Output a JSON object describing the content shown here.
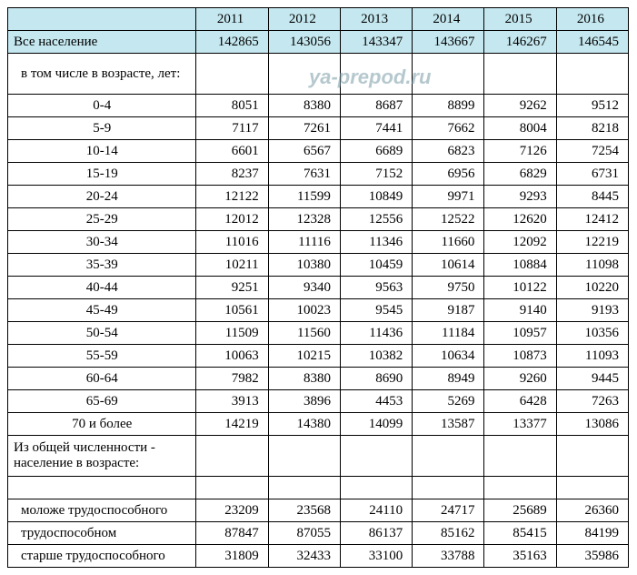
{
  "watermark": "ya-prepod.ru",
  "years": [
    "2011",
    "2012",
    "2013",
    "2014",
    "2015",
    "2016"
  ],
  "total_label": "Все население",
  "total_values": [
    "142865",
    "143056",
    "143347",
    "143667",
    "146267",
    "146545"
  ],
  "age_header": "в том числе в возрасте, лет:",
  "age_rows": [
    {
      "label": "0-4",
      "values": [
        "8051",
        "8380",
        "8687",
        "8899",
        "9262",
        "9512"
      ]
    },
    {
      "label": "5-9",
      "values": [
        "7117",
        "7261",
        "7441",
        "7662",
        "8004",
        "8218"
      ]
    },
    {
      "label": "10-14",
      "values": [
        "6601",
        "6567",
        "6689",
        "6823",
        "7126",
        "7254"
      ]
    },
    {
      "label": "15-19",
      "values": [
        "8237",
        "7631",
        "7152",
        "6956",
        "6829",
        "6731"
      ]
    },
    {
      "label": "20-24",
      "values": [
        "12122",
        "11599",
        "10849",
        "9971",
        "9293",
        "8445"
      ]
    },
    {
      "label": "25-29",
      "values": [
        "12012",
        "12328",
        "12556",
        "12522",
        "12620",
        "12412"
      ]
    },
    {
      "label": "30-34",
      "values": [
        "11016",
        "11116",
        "11346",
        "11660",
        "12092",
        "12219"
      ]
    },
    {
      "label": "35-39",
      "values": [
        "10211",
        "10380",
        "10459",
        "10614",
        "10884",
        "11098"
      ]
    },
    {
      "label": "40-44",
      "values": [
        "9251",
        "9340",
        "9563",
        "9750",
        "10122",
        "10220"
      ]
    },
    {
      "label": "45-49",
      "values": [
        "10561",
        "10023",
        "9545",
        "9187",
        "9140",
        "9193"
      ]
    },
    {
      "label": "50-54",
      "values": [
        "11509",
        "11560",
        "11436",
        "11184",
        "10957",
        "10356"
      ]
    },
    {
      "label": "55-59",
      "values": [
        "10063",
        "10215",
        "10382",
        "10634",
        "10873",
        "11093"
      ]
    },
    {
      "label": "60-64",
      "values": [
        "7982",
        "8380",
        "8690",
        "8949",
        "9260",
        "9445"
      ]
    },
    {
      "label": "65-69",
      "values": [
        "3913",
        "3896",
        "4453",
        "5269",
        "6428",
        "7263"
      ]
    },
    {
      "label": "70 и более",
      "values": [
        "14219",
        "14380",
        "14099",
        "13587",
        "13377",
        "13086"
      ]
    }
  ],
  "group_header": "Из общей численности - население в возрасте:",
  "group_rows": [
    {
      "label": "моложе трудоспособного",
      "values": [
        "23209",
        "23568",
        "24110",
        "24717",
        "25689",
        "26360"
      ]
    },
    {
      "label": "трудоспособном",
      "values": [
        "87847",
        "87055",
        "86137",
        "85162",
        "85415",
        "84199"
      ]
    },
    {
      "label": "старше трудоспособного",
      "values": [
        "31809",
        "32433",
        "33100",
        "33788",
        "35163",
        "35986"
      ]
    }
  ],
  "chart_data": {
    "type": "table",
    "title": "Население по возрастным группам",
    "columns": [
      "2011",
      "2012",
      "2013",
      "2014",
      "2015",
      "2016"
    ],
    "rows": [
      {
        "label": "Все население",
        "values": [
          142865,
          143056,
          143347,
          143667,
          146267,
          146545
        ]
      },
      {
        "label": "0-4",
        "values": [
          8051,
          8380,
          8687,
          8899,
          9262,
          9512
        ]
      },
      {
        "label": "5-9",
        "values": [
          7117,
          7261,
          7441,
          7662,
          8004,
          8218
        ]
      },
      {
        "label": "10-14",
        "values": [
          6601,
          6567,
          6689,
          6823,
          7126,
          7254
        ]
      },
      {
        "label": "15-19",
        "values": [
          8237,
          7631,
          7152,
          6956,
          6829,
          6731
        ]
      },
      {
        "label": "20-24",
        "values": [
          12122,
          11599,
          10849,
          9971,
          9293,
          8445
        ]
      },
      {
        "label": "25-29",
        "values": [
          12012,
          12328,
          12556,
          12522,
          12620,
          12412
        ]
      },
      {
        "label": "30-34",
        "values": [
          11016,
          11116,
          11346,
          11660,
          12092,
          12219
        ]
      },
      {
        "label": "35-39",
        "values": [
          10211,
          10380,
          10459,
          10614,
          10884,
          11098
        ]
      },
      {
        "label": "40-44",
        "values": [
          9251,
          9340,
          9563,
          9750,
          10122,
          10220
        ]
      },
      {
        "label": "45-49",
        "values": [
          10561,
          10023,
          9545,
          9187,
          9140,
          9193
        ]
      },
      {
        "label": "50-54",
        "values": [
          11509,
          11560,
          11436,
          11184,
          10957,
          10356
        ]
      },
      {
        "label": "55-59",
        "values": [
          10063,
          10215,
          10382,
          10634,
          10873,
          11093
        ]
      },
      {
        "label": "60-64",
        "values": [
          7982,
          8380,
          8690,
          8949,
          9260,
          9445
        ]
      },
      {
        "label": "65-69",
        "values": [
          3913,
          3896,
          4453,
          5269,
          6428,
          7263
        ]
      },
      {
        "label": "70 и более",
        "values": [
          14219,
          14380,
          14099,
          13587,
          13377,
          13086
        ]
      },
      {
        "label": "моложе трудоспособного",
        "values": [
          23209,
          23568,
          24110,
          24717,
          25689,
          26360
        ]
      },
      {
        "label": "трудоспособном",
        "values": [
          87847,
          87055,
          86137,
          85162,
          85415,
          84199
        ]
      },
      {
        "label": "старше трудоспособного",
        "values": [
          31809,
          32433,
          33100,
          33788,
          35163,
          35986
        ]
      }
    ]
  }
}
